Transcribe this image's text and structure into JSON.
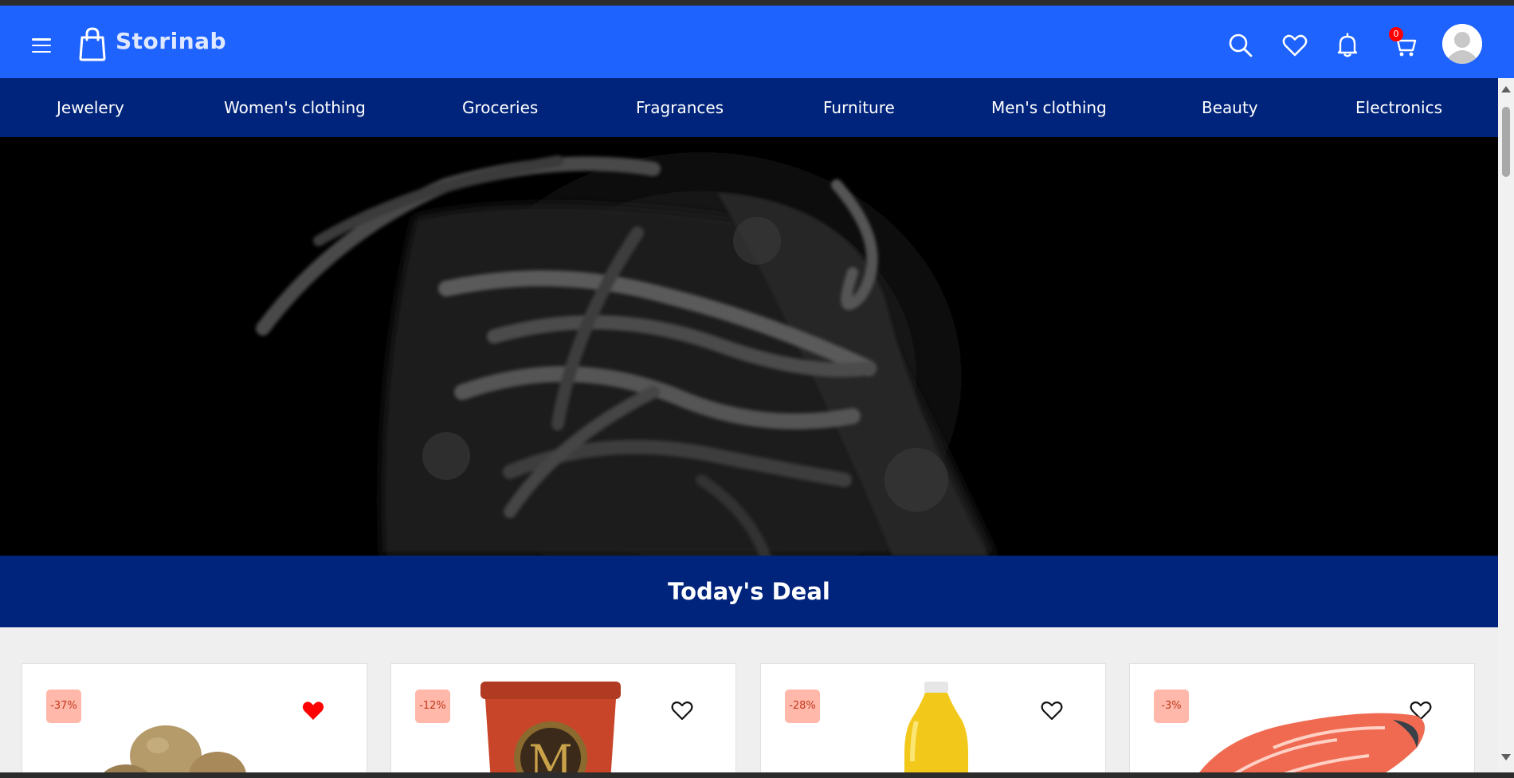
{
  "header": {
    "brand": "Storinab",
    "brand_color": "#1f63ff",
    "icons": [
      "menu-icon",
      "shopping-bag-icon",
      "search-icon",
      "heart-icon",
      "bell-icon",
      "cart-icon",
      "avatar-icon"
    ],
    "cart_count": "0"
  },
  "nav": {
    "background": "#00247b",
    "items": [
      {
        "label": "Jewelery"
      },
      {
        "label": "Women's clothing"
      },
      {
        "label": "Groceries"
      },
      {
        "label": "Fragrances"
      },
      {
        "label": "Furniture"
      },
      {
        "label": "Men's clothing"
      },
      {
        "label": "Beauty"
      },
      {
        "label": "Electronics"
      }
    ]
  },
  "deal": {
    "title": "Today's Deal"
  },
  "products": [
    {
      "discount": "-37%",
      "favorited": true,
      "image": "potatoes"
    },
    {
      "discount": "-12%",
      "favorited": false,
      "image": "ice-cream-tub"
    },
    {
      "discount": "-28%",
      "favorited": false,
      "image": "juice-bottle"
    },
    {
      "discount": "-3%",
      "favorited": false,
      "image": "salmon-fillet"
    }
  ]
}
